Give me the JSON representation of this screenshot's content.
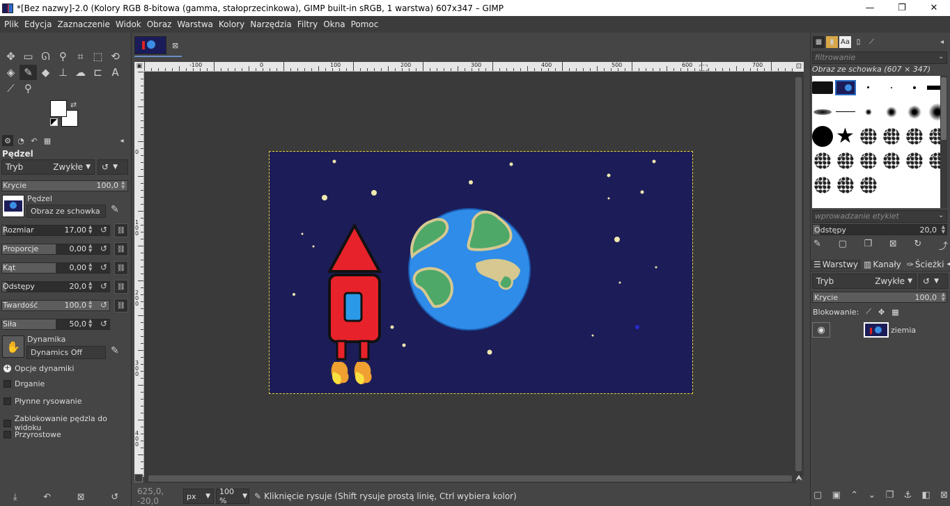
{
  "window": {
    "title": "*[Bez nazwy]-2.0 (Kolory RGB 8-bitowa (gamma, stałoprzecinkowa), GIMP built-in sRGB, 1 warstwa) 607x347 – GIMP",
    "minimize": "—",
    "maximize": "❐",
    "close": "✕"
  },
  "menu": [
    "Plik",
    "Edycja",
    "Zaznaczenie",
    "Widok",
    "Obraz",
    "Warstwa",
    "Kolory",
    "Narzędzia",
    "Filtry",
    "Okna",
    "Pomoc"
  ],
  "toolbox": {
    "rows": [
      [
        {
          "icon": "move-icon",
          "glyph": "✥"
        },
        {
          "icon": "rect-select-icon",
          "glyph": "▭"
        },
        {
          "icon": "free-select-icon",
          "glyph": "ᘏ"
        },
        {
          "icon": "fuzzy-select-icon",
          "glyph": "⚲"
        },
        {
          "icon": "crop-icon",
          "glyph": "⌗"
        },
        {
          "icon": "unified-transform-icon",
          "glyph": "⬚"
        },
        {
          "icon": "warp-icon",
          "glyph": "⟲"
        }
      ],
      [
        {
          "icon": "bucket-fill-icon",
          "glyph": "◈"
        },
        {
          "icon": "paintbrush-icon",
          "glyph": "✎",
          "active": true
        },
        {
          "icon": "eraser-icon",
          "glyph": "◆"
        },
        {
          "icon": "clone-icon",
          "glyph": "⊥"
        },
        {
          "icon": "smudge-icon",
          "glyph": "☁"
        },
        {
          "icon": "dodge-icon",
          "glyph": "⊏"
        },
        {
          "icon": "text-icon",
          "glyph": "A"
        }
      ],
      [
        {
          "icon": "color-picker-icon",
          "glyph": "⟋"
        },
        {
          "icon": "zoom-icon",
          "glyph": "⚲"
        }
      ]
    ],
    "fg_color": "#ffffff",
    "bg_color": "#ffffff"
  },
  "tool_options": {
    "title": "Pędzel",
    "mode_label": "Tryb",
    "mode_value": "Zwykłe",
    "sliders": [
      {
        "label": "Krycie",
        "value": "100,0",
        "fill": 1.0
      },
      {
        "label": "Rozmiar",
        "value": "17,00",
        "fill": 0.03
      },
      {
        "label": "Proporcje",
        "value": "0,00",
        "fill": 0.5
      },
      {
        "label": "Kąt",
        "value": "0,00",
        "fill": 0.5
      },
      {
        "label": "Odstępy",
        "value": "20,0",
        "fill": 0.04
      },
      {
        "label": "Twardość",
        "value": "100,0",
        "fill": 1.0
      },
      {
        "label": "Siła",
        "value": "50,0",
        "fill": 0.5
      }
    ],
    "brush_label": "Pędzel",
    "brush_value": "Obraz ze schowka",
    "dynamics_label": "Dynamika",
    "dynamics_value": "Dynamics Off",
    "checkboxes": [
      "Opcje dynamiki",
      "Drganie",
      "Płynne rysowanie",
      "Zablokowanie pędzla do widoku",
      "Przyrostowe"
    ]
  },
  "canvas": {
    "image_tab_close": "⊠",
    "ruler_h_labels": [
      "-100",
      "0",
      "100",
      "200",
      "300",
      "400",
      "500",
      "600",
      "700"
    ],
    "ruler_v_labels": [
      "0",
      "100",
      "200",
      "300",
      "400"
    ],
    "status_unit": "px",
    "status_zoom": "100 %",
    "status_coords": "625,0, -20,0",
    "status_message": "Kliknięcie rysuje (Shift rysuje prostą linię, Ctrl wybiera kolor)"
  },
  "brushes_panel": {
    "filter_placeholder": "filtrowanie",
    "brush_name": "Obraz ze schowka (607 × 347)",
    "tag_placeholder": "wprowadzanie etykiet",
    "spacing_label": "Odstępy",
    "spacing_value": "20,0"
  },
  "layers_panel": {
    "tabs": [
      "Warstwy",
      "Kanały",
      "Ścieżki"
    ],
    "mode_label": "Tryb",
    "mode_value": "Zwykłe",
    "opacity_label": "Krycie",
    "opacity_value": "100,0",
    "lock_label": "Blokowanie:",
    "layer_name": "ziemia"
  }
}
